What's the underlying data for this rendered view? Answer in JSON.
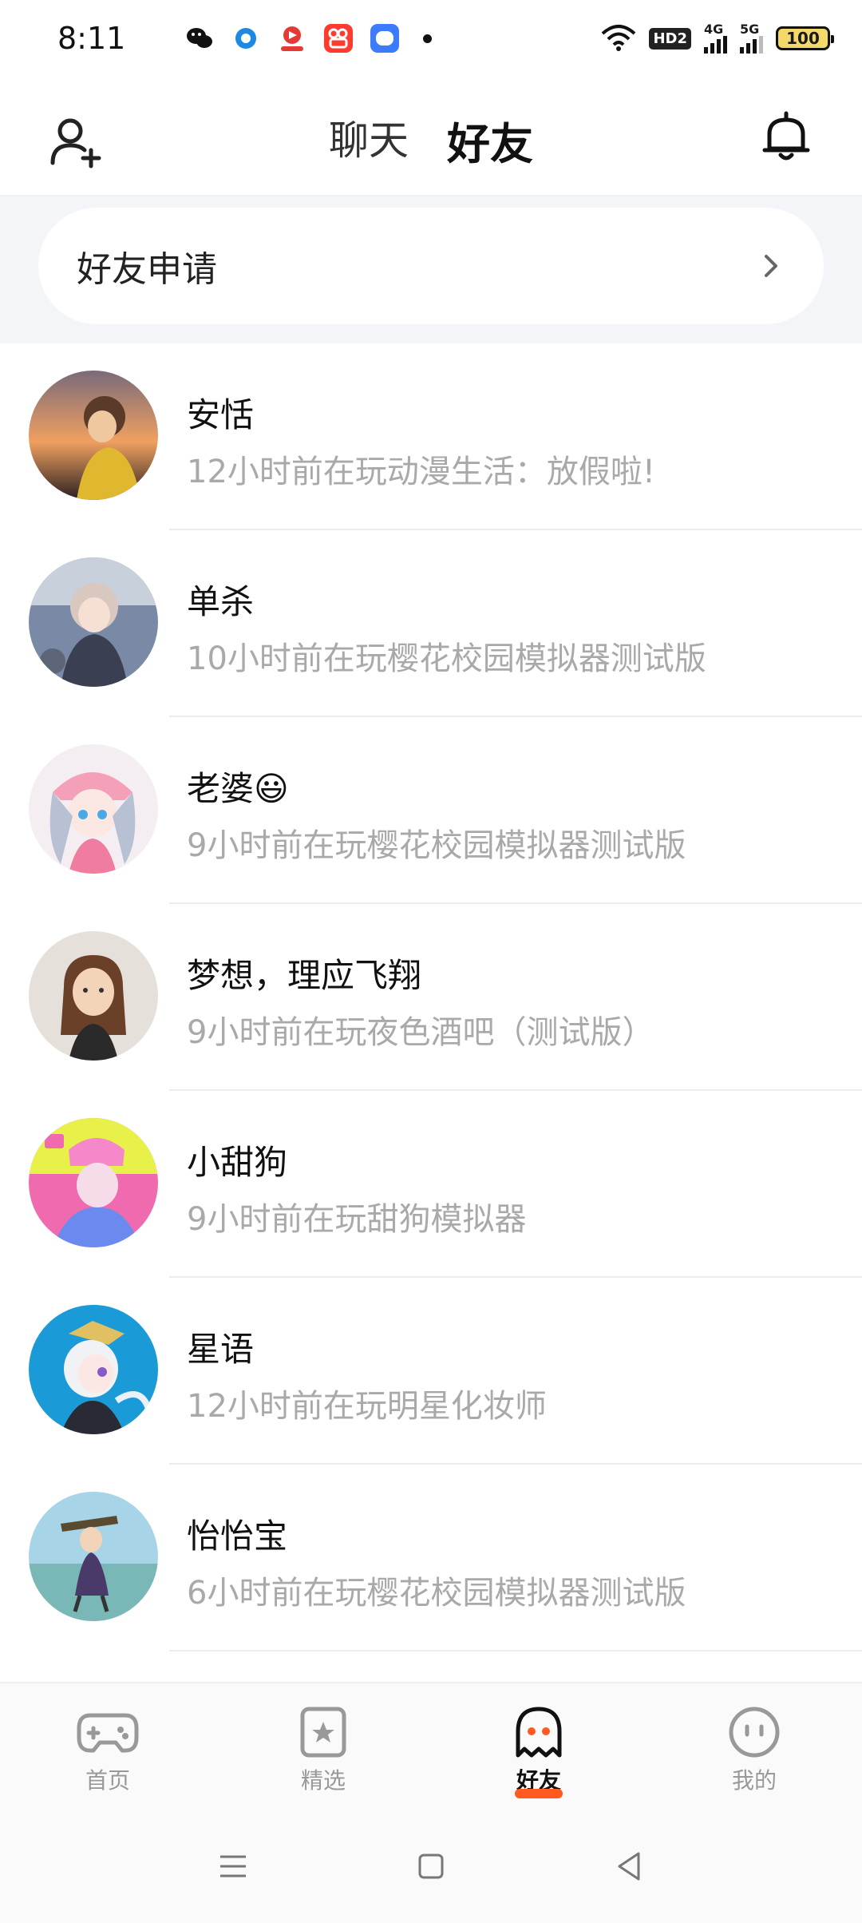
{
  "statusbar": {
    "time": "8:11",
    "network_label": "HD2",
    "sig1_label": "4G",
    "sig2_label": "5G",
    "battery": "100"
  },
  "header": {
    "tabs": [
      {
        "label": "聊天",
        "active": false
      },
      {
        "label": "好友",
        "active": true
      }
    ]
  },
  "friend_request": {
    "label": "好友申请"
  },
  "friends": [
    {
      "name": "安恬",
      "status": "12小时前在玩动漫生活：放假啦!"
    },
    {
      "name": "单杀",
      "status": "10小时前在玩樱花校园模拟器测试版"
    },
    {
      "name": "老婆😃",
      "status": "9小时前在玩樱花校园模拟器测试版"
    },
    {
      "name": "梦想，理应飞翔",
      "status": "9小时前在玩夜色酒吧（测试版）"
    },
    {
      "name": "小甜狗",
      "status": "9小时前在玩甜狗模拟器"
    },
    {
      "name": "星语",
      "status": "12小时前在玩明星化妆师"
    },
    {
      "name": "怡怡宝",
      "status": "6小时前在玩樱花校园模拟器测试版"
    }
  ],
  "bottom_nav": [
    {
      "label": "首页",
      "icon": "gamepad-icon",
      "active": false
    },
    {
      "label": "精选",
      "icon": "star-bookmark-icon",
      "active": false
    },
    {
      "label": "好友",
      "icon": "ghost-icon",
      "active": true
    },
    {
      "label": "我的",
      "icon": "face-icon",
      "active": false
    }
  ],
  "colors": {
    "accent": "#ff5a1f",
    "secondary_text": "#a9a9a9"
  }
}
